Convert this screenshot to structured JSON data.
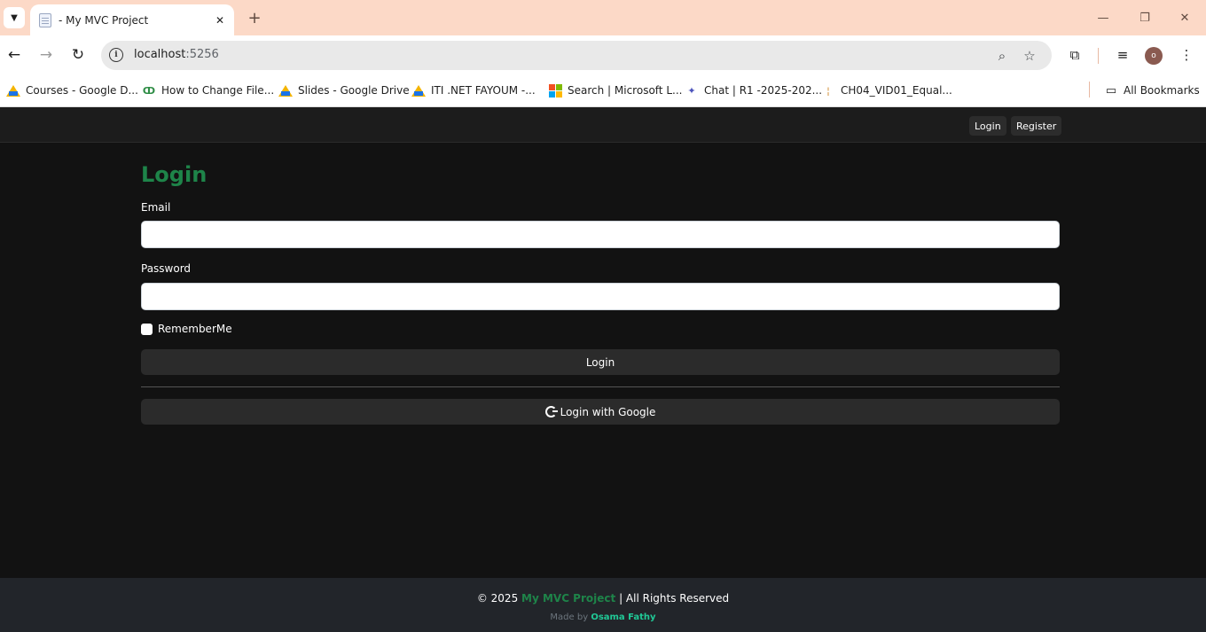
{
  "browser": {
    "tab_title": "- My MVC Project",
    "tab_close": "✕",
    "new_tab": "+",
    "url_host": "localhost",
    "url_port": ":5256",
    "bookmarks": [
      {
        "label": "Courses - Google D...",
        "icon": "google-drive-icon"
      },
      {
        "label": "How to Change File...",
        "icon": "geeksforgeeks-icon"
      },
      {
        "label": "Slides - Google Drive",
        "icon": "google-drive-icon"
      },
      {
        "label": "ITI .NET FAYOUM -...",
        "icon": "google-drive-icon"
      },
      {
        "label": "Search | Microsoft L...",
        "icon": "microsoft-icon"
      },
      {
        "label": "Chat | R1 -2025-202...",
        "icon": "teams-icon"
      },
      {
        "label": "CH04_VID01_Equal...",
        "icon": "bookmark-icon"
      }
    ],
    "all_bookmarks": "All Bookmarks",
    "profile_initial": "o"
  },
  "nav": {
    "login": "Login",
    "register": "Register"
  },
  "form": {
    "title": "Login",
    "email_label": "Email",
    "email_value": "",
    "password_label": "Password",
    "password_value": "",
    "remember_label": "RememberMe",
    "login_button": "Login",
    "google_button": "Login with Google"
  },
  "footer": {
    "copyright": "© 2025",
    "brand": "My MVC Project",
    "rights": "| All Rights Reserved",
    "made_by": "Made by",
    "author": "Osama Fathy"
  },
  "colors": {
    "tab_bar": "#fcd9c7",
    "page_bg": "#121212",
    "title_green": "#1e8449",
    "footer_bg": "#22252a"
  }
}
